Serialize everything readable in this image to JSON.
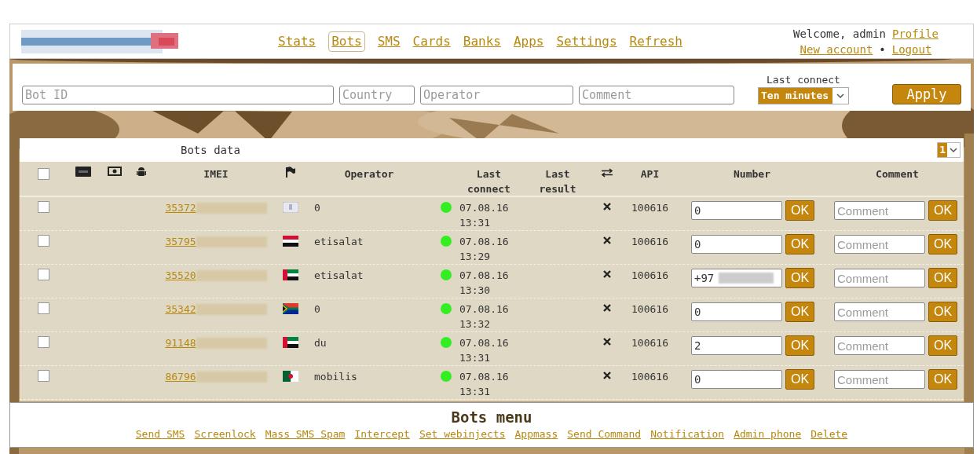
{
  "header": {
    "nav": [
      {
        "label": "Stats",
        "selected": false
      },
      {
        "label": "Bots",
        "selected": true
      },
      {
        "label": "SMS",
        "selected": false
      },
      {
        "label": "Cards",
        "selected": false
      },
      {
        "label": "Banks",
        "selected": false
      },
      {
        "label": "Apps",
        "selected": false
      },
      {
        "label": "Settings",
        "selected": false
      },
      {
        "label": "Refresh",
        "selected": false
      }
    ],
    "welcome": "Welcome, admin",
    "profile_link": "Profile",
    "new_account_link": "New account",
    "separator": "•",
    "logout_link": "Logout"
  },
  "filters": {
    "bot_id": {
      "placeholder": "Bot ID"
    },
    "country": {
      "placeholder": "Country"
    },
    "operator": {
      "placeholder": "Operator"
    },
    "comment": {
      "placeholder": "Comment"
    },
    "last_connect_label": "Last connect",
    "last_connect_value": "Ten minutes",
    "apply": "Apply"
  },
  "table": {
    "title": "Bots data",
    "page": "1",
    "select_all_checked": false,
    "columns": {
      "imei": "IMEI",
      "operator": "Operator",
      "last_connect": "Last connect",
      "last_result": "Last result",
      "api": "API",
      "number": "Number",
      "comment": "Comment"
    },
    "rows": [
      {
        "checked": false,
        "imei": "35372",
        "kind": "unknown",
        "operator": "0",
        "color": "#33ee22",
        "last_connect": "07.08.16 13:31",
        "api": "100616",
        "number": "0",
        "number_redacted": false,
        "number_ok": "OK",
        "comment_placeholder": "Comment",
        "comment_ok": "OK"
      },
      {
        "checked": false,
        "imei": "35795",
        "kind": "eg",
        "operator": "etisalat",
        "color": "#33ee22",
        "last_connect": "07.08.16 13:29",
        "api": "100616",
        "number": "0",
        "number_redacted": false,
        "number_ok": "OK",
        "comment_placeholder": "Comment",
        "comment_ok": "OK"
      },
      {
        "checked": false,
        "imei": "35520",
        "kind": "ae",
        "operator": "etisalat",
        "color": "#33ee22",
        "last_connect": "07.08.16 13:30",
        "api": "100616",
        "number": "+97",
        "number_redacted": true,
        "number_ok": "OK",
        "comment_placeholder": "Comment",
        "comment_ok": "OK"
      },
      {
        "checked": false,
        "imei": "35342",
        "kind": "za",
        "operator": "0",
        "color": "#33ee22",
        "last_connect": "07.08.16 13:32",
        "api": "100616",
        "number": "0",
        "number_redacted": false,
        "number_ok": "OK",
        "comment_placeholder": "Comment",
        "comment_ok": "OK"
      },
      {
        "checked": false,
        "imei": "91148",
        "kind": "ae",
        "operator": "du",
        "color": "#33ee22",
        "last_connect": "07.08.16 13:31",
        "api": "100616",
        "number": "2",
        "number_redacted": false,
        "number_ok": "OK",
        "comment_placeholder": "Comment",
        "comment_ok": "OK"
      },
      {
        "checked": false,
        "imei": "86796",
        "kind": "dz",
        "operator": "mobilis",
        "color": "#33ee22",
        "last_connect": "07.08.16 13:31",
        "api": "100616",
        "number": "0",
        "number_redacted": false,
        "number_ok": "OK",
        "comment_placeholder": "Comment",
        "comment_ok": "OK"
      }
    ]
  },
  "bots_menu": {
    "title": "Bots menu",
    "links": [
      "Send SMS",
      "Screenlock",
      "Mass SMS Spam",
      "Intercept",
      "Set webinjects",
      "Appmass",
      "Send Command",
      "Notification",
      "Admin phone",
      "Delete"
    ]
  }
}
